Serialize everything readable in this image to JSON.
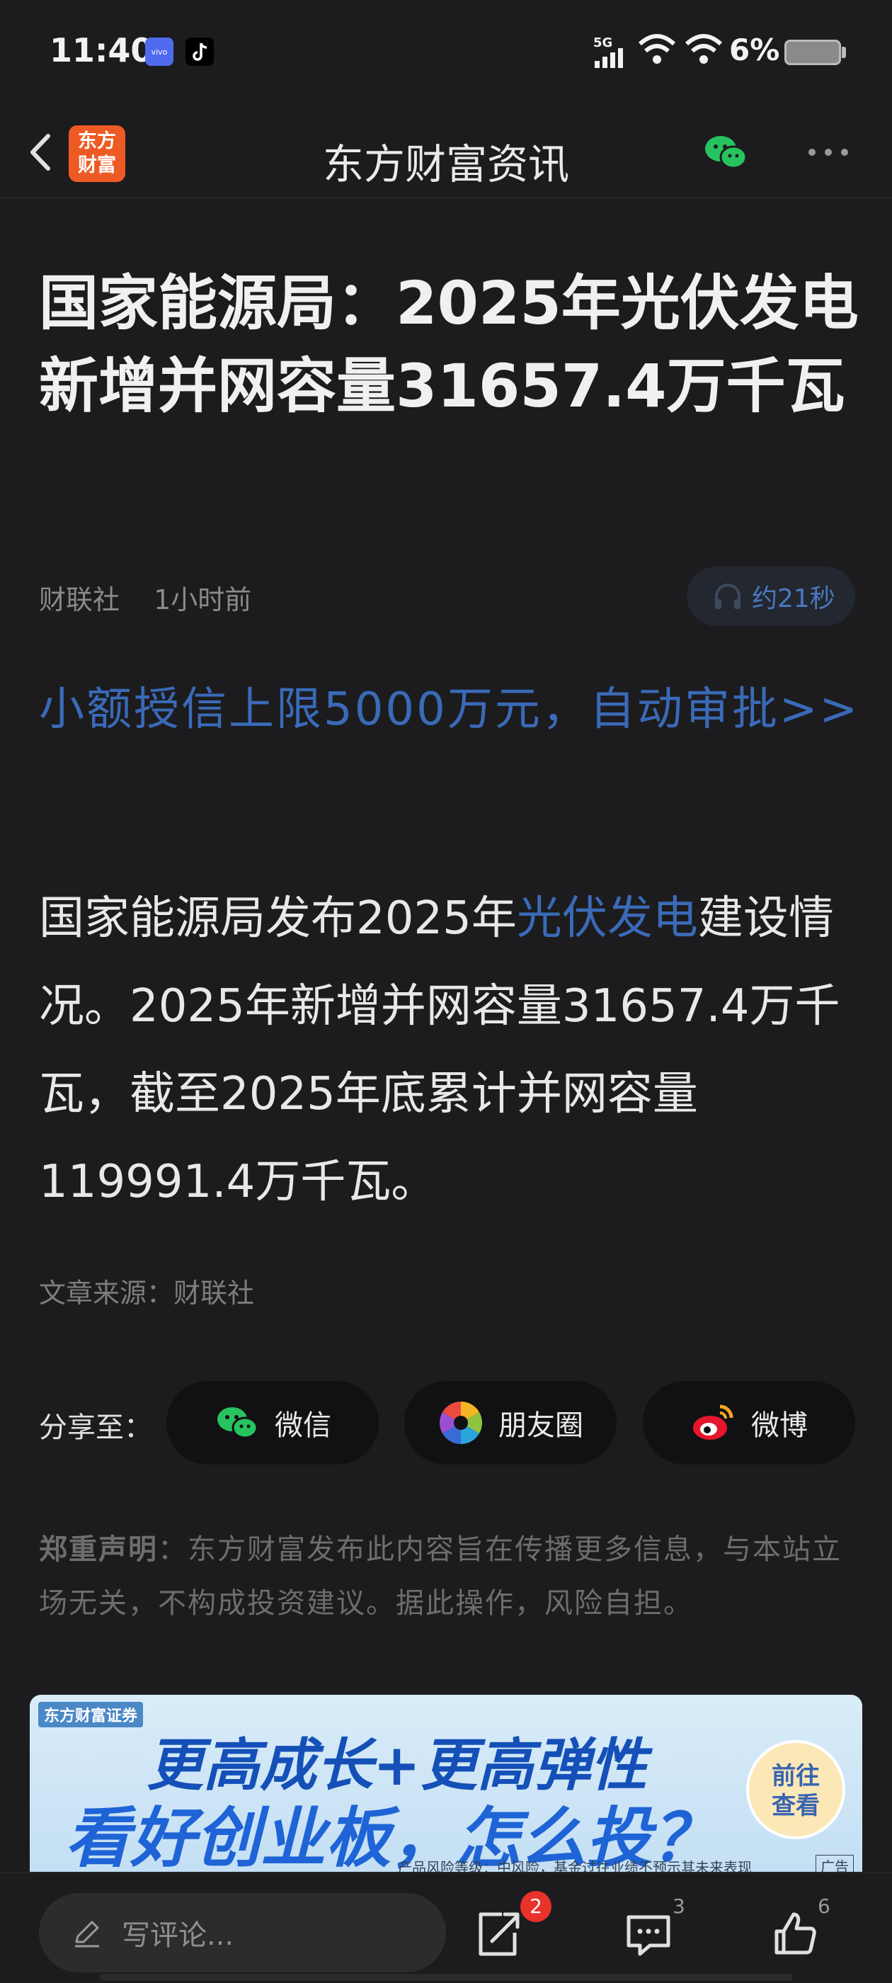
{
  "status": {
    "time": "11:40",
    "signal": "5G",
    "battery": "6%"
  },
  "nav": {
    "title": "东方财富资讯",
    "logo_line1": "东方",
    "logo_line2": "财富"
  },
  "article": {
    "title": "国家能源局：2025年光伏发电新增并网容量31657.4万千瓦",
    "source_name": "财联社",
    "time_ago": "1小时前",
    "audio_duration": "约21秒",
    "promo_link": "小额授信上限5000万元，自动审批>>",
    "body_before": "国家能源局发布2025年",
    "body_link": "光伏发电",
    "body_after": "建设情况。2025年新增并网容量31657.4万千瓦，截至2025年底累计并网容量119991.4万千瓦。",
    "source_line": "文章来源：财联社"
  },
  "share": {
    "label": "分享至：",
    "wechat": "微信",
    "moments": "朋友圈",
    "weibo": "微博"
  },
  "disclaimer": {
    "title": "郑重声明",
    "text": "：东方财富发布此内容旨在传播更多信息，与本站立场无关，不构成投资建议。据此操作，风险自担。"
  },
  "banner": {
    "brand": "东方财富证券",
    "line1": "更高成长+更高弹性",
    "line2": "看好创业板，怎么投？",
    "cta_line1": "前往",
    "cta_line2": "查看",
    "risk": "产品风险等级：中风险，基金过往业绩不预示其未来表现",
    "ad_tag": "广告"
  },
  "bottom": {
    "comment_placeholder": "写评论...",
    "share_badge": "2",
    "comment_count": "3",
    "like_count": "6"
  }
}
